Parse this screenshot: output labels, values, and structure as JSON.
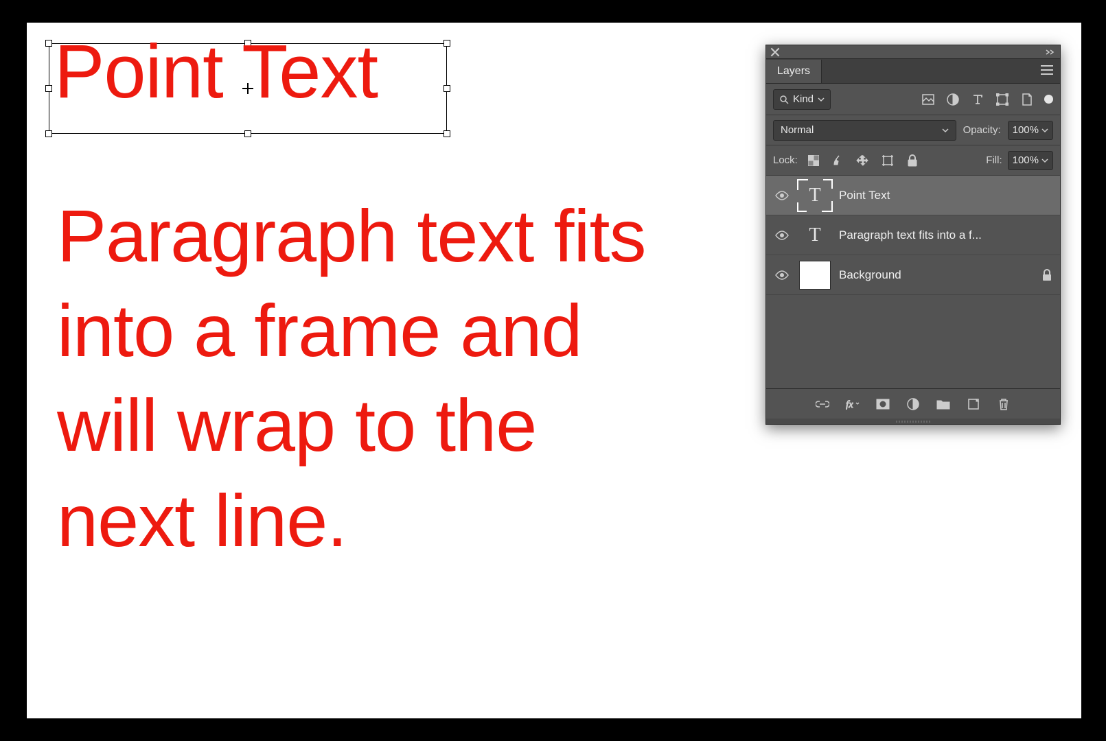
{
  "canvas": {
    "point_text": "Point Text",
    "paragraph_text": "Paragraph text fits into a frame and will wrap to the next line.",
    "text_color": "#ed1a0f"
  },
  "panel": {
    "title": "Layers",
    "filter": {
      "kind_label": "Kind"
    },
    "blend": {
      "mode": "Normal",
      "opacity_label": "Opacity:",
      "opacity_value": "100%"
    },
    "lock": {
      "label": "Lock:",
      "fill_label": "Fill:",
      "fill_value": "100%"
    },
    "layers": [
      {
        "name": "Point Text",
        "type": "text",
        "selected": true,
        "locked": false
      },
      {
        "name": "Paragraph text fits into a f...",
        "type": "text",
        "selected": false,
        "locked": false
      },
      {
        "name": "Background",
        "type": "raster",
        "selected": false,
        "locked": true
      }
    ]
  }
}
